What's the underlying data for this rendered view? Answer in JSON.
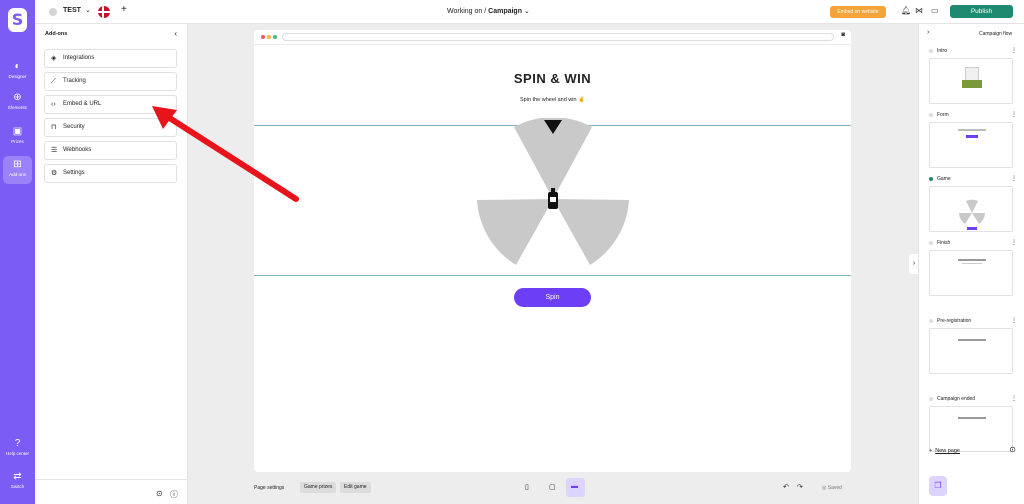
{
  "rail": {
    "items": [
      {
        "label": "Designer",
        "icon": "palette-icon"
      },
      {
        "label": "Elements",
        "icon": "plus-circle-icon"
      },
      {
        "label": "Prizes",
        "icon": "gift-icon"
      },
      {
        "label": "Add-ons",
        "icon": "grid-plus-icon"
      }
    ],
    "help_label": "Help center",
    "switch_label": "Switch"
  },
  "topbar": {
    "project_name": "TEST",
    "breadcrumb_prefix": "Working on",
    "breadcrumb_sep": "/",
    "breadcrumb_current": "Campaign",
    "embed_label": "Embed on website",
    "publish_label": "Publish"
  },
  "addons": {
    "title": "Add-ons",
    "items": [
      {
        "label": "Integrations",
        "icon": "layers-icon"
      },
      {
        "label": "Tracking",
        "icon": "chart-line-icon"
      },
      {
        "label": "Embed & URL",
        "icon": "code-icon"
      },
      {
        "label": "Security",
        "icon": "lock-icon"
      },
      {
        "label": "Webhooks",
        "icon": "database-icon"
      },
      {
        "label": "Settings",
        "icon": "gear-icon"
      }
    ]
  },
  "canvas": {
    "headline": "SPIN & WIN",
    "subline": "Spin the wheel and win ✌",
    "spin_label": "Spin"
  },
  "bottombar": {
    "page_settings_label": "Page settings",
    "game_prizes_label": "Game prizes",
    "edit_game_label": "Edit game",
    "saved_label": "Saved"
  },
  "flow": {
    "title": "Campaign flow",
    "items": [
      {
        "name": "Intro",
        "active": false
      },
      {
        "name": "Form",
        "active": false
      },
      {
        "name": "Game",
        "active": true
      },
      {
        "name": "Finish",
        "active": false
      },
      {
        "name": "Pre-registration",
        "active": false
      },
      {
        "name": "Campaign ended",
        "active": false
      }
    ],
    "new_page_label": "New page"
  },
  "colors": {
    "rail": "#7b5cf5",
    "publish": "#1f8a70",
    "embed": "#f5a43a",
    "spin": "#6c3ef5",
    "annotation_arrow": "#e8141c"
  }
}
